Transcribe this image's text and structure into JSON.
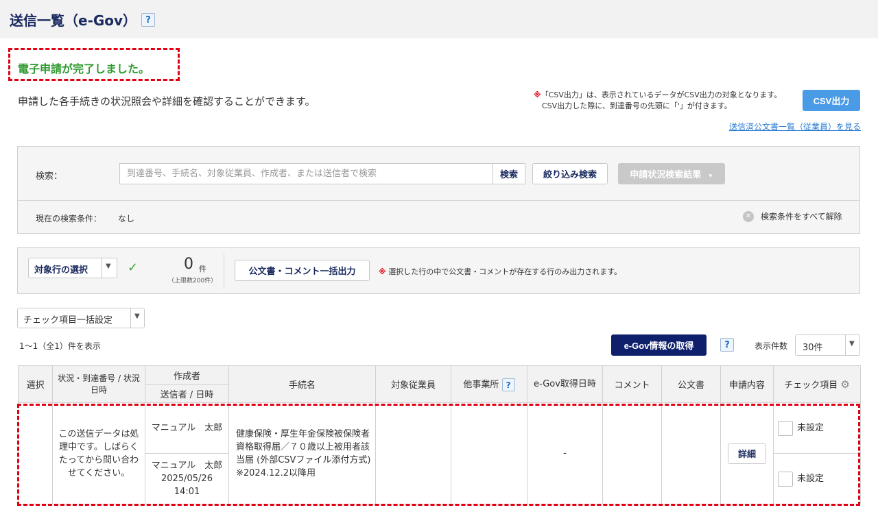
{
  "header": {
    "title": "送信一覧（e-Gov）",
    "help": "?"
  },
  "done_message": "電子申請が完了しました。",
  "description": "申請した各手続きの状況照会や詳細を確認することができます。",
  "csv": {
    "note_mark": "※",
    "note_line1": "「CSV出力」は、表示されているデータがCSV出力の対象となります。",
    "note_line2": "CSV出力した際に、到達番号の先頭に「'」が付きます。",
    "button": "CSV出力"
  },
  "sent_docs_link": "送信済公文書一覧（従業員）を見る",
  "search": {
    "label": "検索：",
    "placeholder": "到達番号、手続名、対象従業員、作成者、または送信者で検索",
    "search_button": "検索",
    "filter_button": "絞り込み検索",
    "status_button": "申請状況検索結果",
    "status_arrow": "▼",
    "condition_label": "現在の検索条件：",
    "condition_value": "なし",
    "clear_icon": "✕",
    "clear_label": "検索条件をすべて解除"
  },
  "selection": {
    "row_select_label": "対象行の選択",
    "arrow": "▼",
    "check": "✓",
    "count": "0",
    "count_unit": "件",
    "limit": "（上限数200件）",
    "bulk_button": "公文書・コメント一括出力",
    "note_mark": "※",
    "note": "選択した行の中で公文書・コメントが存在する行のみ出力されます。"
  },
  "check_bulk": {
    "label": "チェック項目一括設定",
    "arrow": "▼"
  },
  "result_count": "1〜1（全1）件を表示",
  "egov_button": "e-Gov情報の取得",
  "help2": "?",
  "per_page": {
    "label": "表示件数",
    "value": "30件",
    "arrow": "▼"
  },
  "table": {
    "headers": {
      "select": "選択",
      "status": "状況・到達番号 / 状況日時",
      "creator": "作成者",
      "sender": "送信者 / 日時",
      "procedure": "手続名",
      "employee": "対象従業員",
      "other_office": "他事業所",
      "other_office_help": "?",
      "egov_date": "e-Gov取得日時",
      "comment": "コメント",
      "official_doc": "公文書",
      "content": "申請内容",
      "check_items": "チェック項目",
      "gear": "⚙"
    },
    "row": {
      "status": "この送信データは処理中です。しばらくたってから問い合わせてください。",
      "creator": "マニュアル　太郎",
      "sender": "マニュアル　太郎",
      "date": "2025/05/26",
      "time": "14:01",
      "procedure": "健康保険・厚生年金保険被保険者資格取得届／７０歳以上被用者該当届 (外部CSVファイル添付方式)　※2024.12.2以降用",
      "egov_date": "-",
      "detail_button": "詳細",
      "check1": "未設定",
      "check2": "未設定"
    }
  }
}
